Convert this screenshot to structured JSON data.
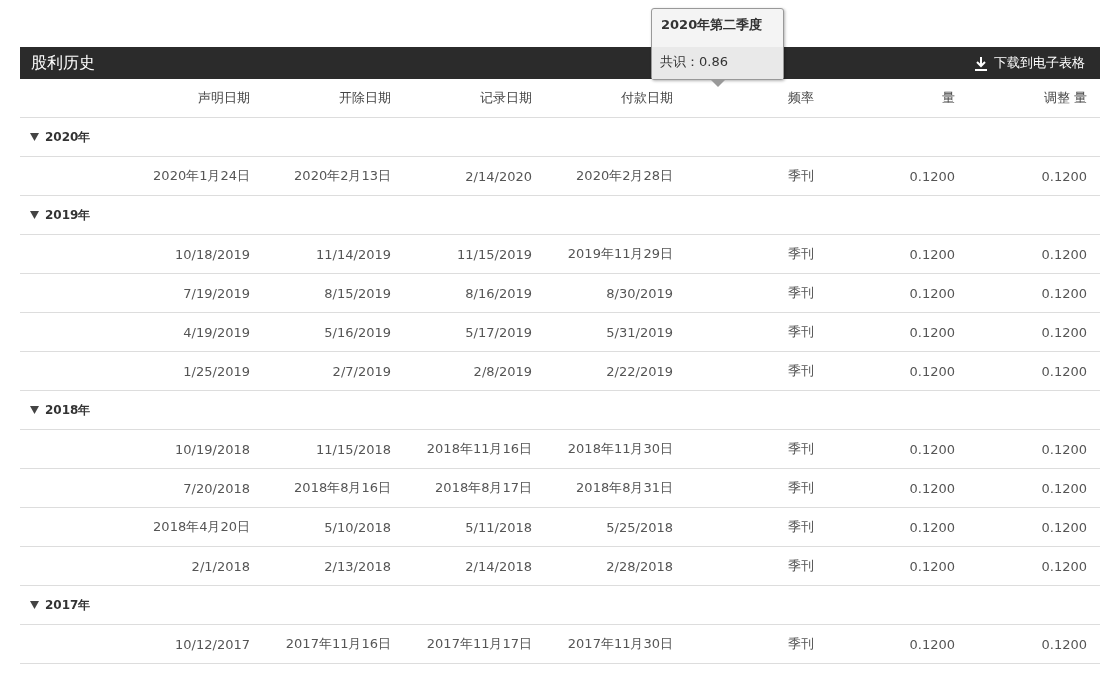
{
  "tooltip": {
    "title": "2020年第二季度",
    "text": "共识：0.86"
  },
  "panel": {
    "title": "股利历史",
    "download": "下载到电子表格"
  },
  "columns": [
    "声明日期",
    "开除日期",
    "记录日期",
    "付款日期",
    "频率",
    "量",
    "调整 量"
  ],
  "groups": [
    {
      "year": "2020年",
      "expanded": true,
      "rows": [
        [
          "2020年1月24日",
          "2020年2月13日",
          "2/14/2020",
          "2020年2月28日",
          "季刊",
          "0.1200",
          "0.1200"
        ]
      ]
    },
    {
      "year": "2019年",
      "expanded": true,
      "rows": [
        [
          "10/18/2019",
          "11/14/2019",
          "11/15/2019",
          "2019年11月29日",
          "季刊",
          "0.1200",
          "0.1200"
        ],
        [
          "7/19/2019",
          "8/15/2019",
          "8/16/2019",
          "8/30/2019",
          "季刊",
          "0.1200",
          "0.1200"
        ],
        [
          "4/19/2019",
          "5/16/2019",
          "5/17/2019",
          "5/31/2019",
          "季刊",
          "0.1200",
          "0.1200"
        ],
        [
          "1/25/2019",
          "2/7/2019",
          "2/8/2019",
          "2/22/2019",
          "季刊",
          "0.1200",
          "0.1200"
        ]
      ]
    },
    {
      "year": "2018年",
      "expanded": true,
      "rows": [
        [
          "10/19/2018",
          "11/15/2018",
          "2018年11月16日",
          "2018年11月30日",
          "季刊",
          "0.1200",
          "0.1200"
        ],
        [
          "7/20/2018",
          "2018年8月16日",
          "2018年8月17日",
          "2018年8月31日",
          "季刊",
          "0.1200",
          "0.1200"
        ],
        [
          "2018年4月20日",
          "5/10/2018",
          "5/11/2018",
          "5/25/2018",
          "季刊",
          "0.1200",
          "0.1200"
        ],
        [
          "2/1/2018",
          "2/13/2018",
          "2/14/2018",
          "2/28/2018",
          "季刊",
          "0.1200",
          "0.1200"
        ]
      ]
    },
    {
      "year": "2017年",
      "expanded": true,
      "rows": [
        [
          "10/12/2017",
          "2017年11月16日",
          "2017年11月17日",
          "2017年11月30日",
          "季刊",
          "0.1200",
          "0.1200"
        ]
      ]
    }
  ]
}
